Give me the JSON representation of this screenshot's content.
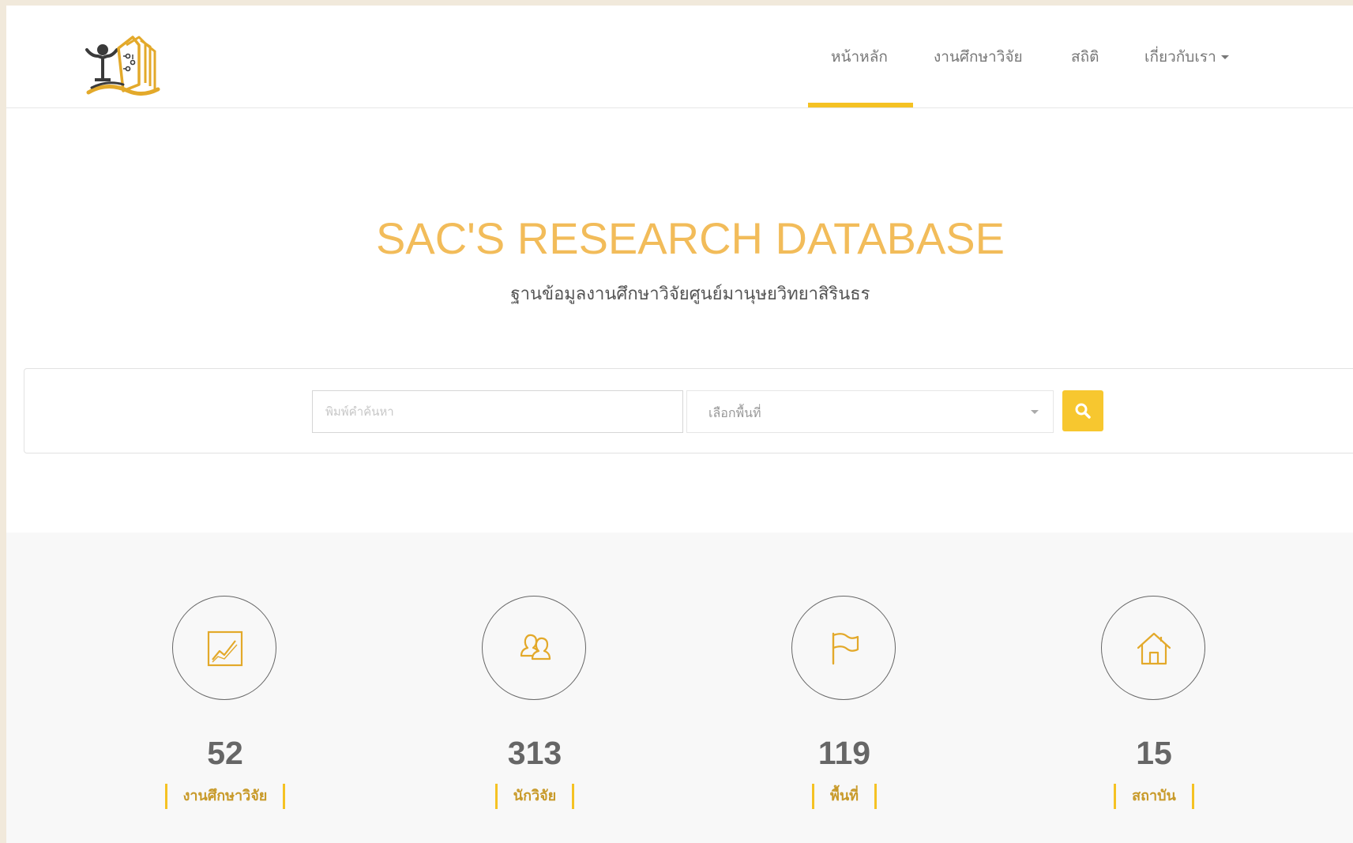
{
  "nav": {
    "items": [
      {
        "label": "หน้าหลัก",
        "active": true
      },
      {
        "label": "งานศึกษาวิจัย",
        "active": false
      },
      {
        "label": "สถิติ",
        "active": false
      },
      {
        "label": "เกี่ยวกับเรา",
        "active": false,
        "dropdown": true
      }
    ],
    "accent_color": "#f5c223"
  },
  "hero": {
    "title": "SAC'S RESEARCH DATABASE",
    "subtitle": "ฐานข้อมูลงานศึกษาวิจัยศูนย์มานุษยวิทยาสิรินธร",
    "title_color": "#f2bc5a"
  },
  "search": {
    "placeholder": "พิมพ์คำค้นหา",
    "value": "",
    "area_select": "เลือกพื้นที่",
    "button_icon": "search-icon",
    "button_color": "#f7c72f"
  },
  "stats": [
    {
      "number": "52",
      "label": "งานศึกษาวิจัย",
      "icon": "chart-icon"
    },
    {
      "number": "313",
      "label": "นักวิจัย",
      "icon": "people-icon"
    },
    {
      "number": "119",
      "label": "พื้นที่",
      "icon": "flag-icon"
    },
    {
      "number": "15",
      "label": "สถาบัน",
      "icon": "home-icon"
    }
  ]
}
